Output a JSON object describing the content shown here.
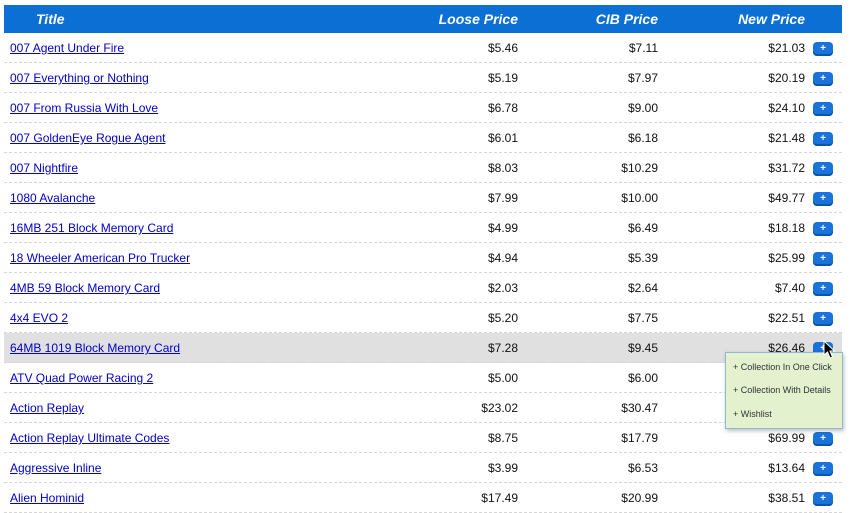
{
  "header": {
    "title": "Title",
    "loose": "Loose Price",
    "cib": "CIB Price",
    "new": "New Price"
  },
  "add_icon": "+",
  "rows": [
    {
      "title": "007 Agent Under Fire",
      "loose": "$5.46",
      "cib": "$7.11",
      "new": "$21.03"
    },
    {
      "title": "007 Everything or Nothing",
      "loose": "$5.19",
      "cib": "$7.97",
      "new": "$20.19"
    },
    {
      "title": "007 From Russia With Love",
      "loose": "$6.78",
      "cib": "$9.00",
      "new": "$24.10"
    },
    {
      "title": "007 GoldenEye Rogue Agent",
      "loose": "$6.01",
      "cib": "$6.18",
      "new": "$21.48"
    },
    {
      "title": "007 Nightfire",
      "loose": "$8.03",
      "cib": "$10.29",
      "new": "$31.72"
    },
    {
      "title": "1080 Avalanche",
      "loose": "$7.99",
      "cib": "$10.00",
      "new": "$49.77"
    },
    {
      "title": "16MB 251 Block Memory Card",
      "loose": "$4.99",
      "cib": "$6.49",
      "new": "$18.18"
    },
    {
      "title": "18 Wheeler American Pro Trucker",
      "loose": "$4.94",
      "cib": "$5.39",
      "new": "$25.99"
    },
    {
      "title": "4MB 59 Block Memory Card",
      "loose": "$2.03",
      "cib": "$2.64",
      "new": "$7.40"
    },
    {
      "title": "4x4 EVO 2",
      "loose": "$5.20",
      "cib": "$7.75",
      "new": "$22.51"
    },
    {
      "title": "64MB 1019 Block Memory Card",
      "loose": "$7.28",
      "cib": "$9.45",
      "new": "$26.46"
    },
    {
      "title": "ATV Quad Power Racing 2",
      "loose": "$5.00",
      "cib": "$6.00",
      "new": ""
    },
    {
      "title": "Action Replay",
      "loose": "$23.02",
      "cib": "$30.47",
      "new": ""
    },
    {
      "title": "Action Replay Ultimate Codes",
      "loose": "$8.75",
      "cib": "$17.79",
      "new": "$69.99"
    },
    {
      "title": "Aggressive Inline",
      "loose": "$3.99",
      "cib": "$6.53",
      "new": "$13.64"
    },
    {
      "title": "Alien Hominid",
      "loose": "$17.49",
      "cib": "$20.99",
      "new": "$38.51"
    }
  ],
  "highlighted_row_index": 10,
  "popup": {
    "items": [
      "+ Collection In One Click",
      "+ Collection With Details",
      "+ Wishlist"
    ]
  },
  "colors": {
    "header_bg": "#0b6fd4",
    "link": "#0000cc",
    "button": "#1a73d8",
    "popup_bg": "#e3f1cf",
    "highlight": "#e0e0e0"
  }
}
